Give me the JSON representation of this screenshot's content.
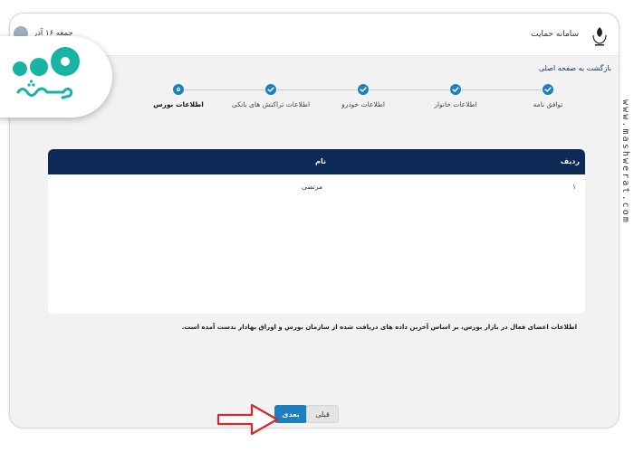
{
  "header": {
    "app_title": "سامانه حمایت",
    "date": "جمعه ۱۶ آذر"
  },
  "nav": {
    "back_link": "بازگشت به صفحه اصلی"
  },
  "steps": [
    {
      "label": "توافق نامه",
      "status": "done"
    },
    {
      "label": "اطلاعات خانوار",
      "status": "done"
    },
    {
      "label": "اطلاعات خودرو",
      "status": "done"
    },
    {
      "label": "اطلاعات تراکنش های بانکی",
      "status": "done"
    },
    {
      "label": "اطلاعات بورس",
      "status": "current",
      "number": "۵"
    }
  ],
  "table": {
    "headers": {
      "row": "ردیف",
      "name": "نام"
    },
    "rows": [
      {
        "row": "۱",
        "name": "مرتضی"
      }
    ]
  },
  "info_note": "اطلاعات اعضای فعال در بازار بورس، بر اساس آخرین داده های دریافت شده از سازمان بورس و اوراق بهادار بدست آمده است.",
  "buttons": {
    "prev": "قبلی",
    "next": "بعدی"
  },
  "overlays": {
    "brand_badge_text": "مشورت",
    "watermark": "www.mashwerat.com",
    "arrow_color": "#d9262c",
    "brand_color": "#17b3a3"
  },
  "colors": {
    "accent": "#1b7fc0",
    "table_header": "#0c2a55"
  }
}
